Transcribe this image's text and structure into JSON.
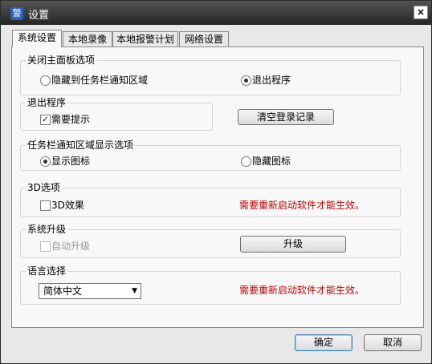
{
  "window": {
    "title": "设置",
    "icon_glyph": "警",
    "close_glyph": "×"
  },
  "tabs": [
    {
      "label": "系统设置",
      "active": true
    },
    {
      "label": "本地录像",
      "active": false
    },
    {
      "label": "本地报警计划",
      "active": false
    },
    {
      "label": "网络设置",
      "active": false
    }
  ],
  "close_panel": {
    "title": "关闭主面板选项",
    "option_hide": "隐藏到任务栏通知区域",
    "option_exit": "退出程序",
    "selected": "option_exit"
  },
  "exit_group": {
    "title": "退出程序",
    "need_prompt_label": "需要提示",
    "need_prompt_checked": true,
    "clear_login_button": "清空登录记录"
  },
  "tray_group": {
    "title": "任务栏通知区域显示选项",
    "option_show": "显示图标",
    "option_hide": "隐藏图标",
    "selected": "option_show"
  },
  "effect3d_group": {
    "title": "3D选项",
    "effect_label": "3D效果",
    "effect_checked": false,
    "restart_note": "需要重新启动软件才能生效。"
  },
  "upgrade_group": {
    "title": "系统升级",
    "auto_upgrade_label": "自动升级",
    "auto_upgrade_checked": false,
    "upgrade_button": "升级"
  },
  "language_group": {
    "title": "语言选择",
    "selected_language": "简体中文",
    "restart_note": "需要重新启动软件才能生效。"
  },
  "footer": {
    "ok_button": "确定",
    "cancel_button": "取消"
  },
  "colors": {
    "warning": "#c00000",
    "titlebar": "#3a3a3a"
  }
}
